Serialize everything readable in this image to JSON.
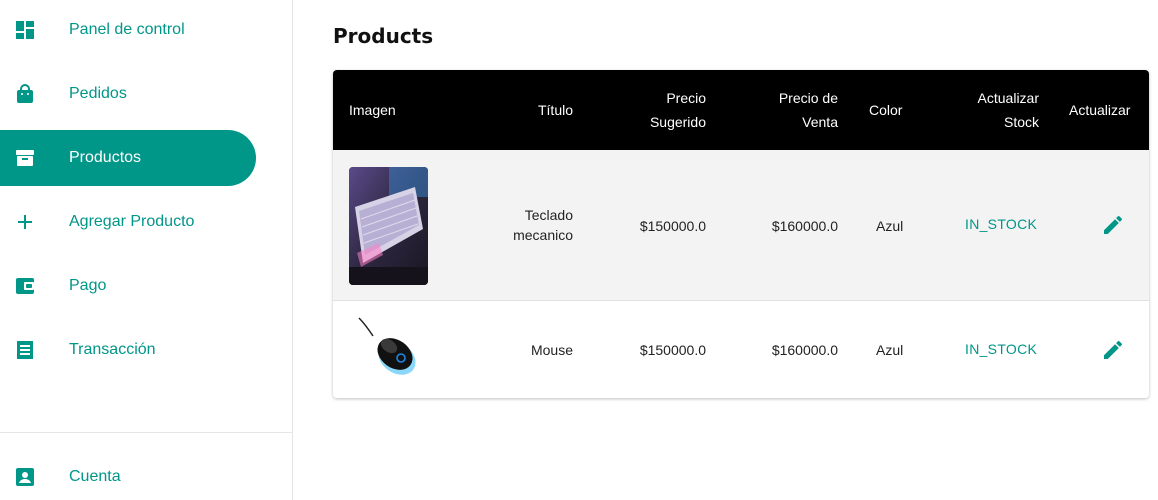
{
  "sidebar": {
    "items": [
      {
        "label": "Panel de control",
        "icon": "dashboard-icon"
      },
      {
        "label": "Pedidos",
        "icon": "shopping-bag-icon"
      },
      {
        "label": "Productos",
        "icon": "archive-icon",
        "active": true
      },
      {
        "label": "Agregar Producto",
        "icon": "add-icon"
      },
      {
        "label": "Pago",
        "icon": "wallet-icon"
      },
      {
        "label": "Transacción",
        "icon": "receipt-icon"
      }
    ],
    "account": {
      "label": "Cuenta",
      "icon": "account-box-icon"
    }
  },
  "page": {
    "title": "Products"
  },
  "table": {
    "headers": {
      "image": "Imagen",
      "title": "Título",
      "suggested_price_1": "Precio",
      "suggested_price_2": "Sugerido",
      "sale_price_1": "Precio de",
      "sale_price_2": "Venta",
      "color": "Color",
      "update_stock_1": "Actualizar",
      "update_stock_2": "Stock",
      "update": "Actualizar"
    },
    "rows": [
      {
        "title_1": "Teclado",
        "title_2": "mecanico",
        "suggested_price": "$150000.0",
        "sale_price": "$160000.0",
        "color": "Azul",
        "stock": "IN_STOCK",
        "image": "keyboard-photo"
      },
      {
        "title": "Mouse",
        "suggested_price": "$150000.0",
        "sale_price": "$160000.0",
        "color": "Azul",
        "stock": "IN_STOCK",
        "image": "mouse-photo"
      }
    ]
  },
  "colors": {
    "accent": "#009688",
    "header_bg": "#000000",
    "row_alt": "#f3f3f3"
  }
}
